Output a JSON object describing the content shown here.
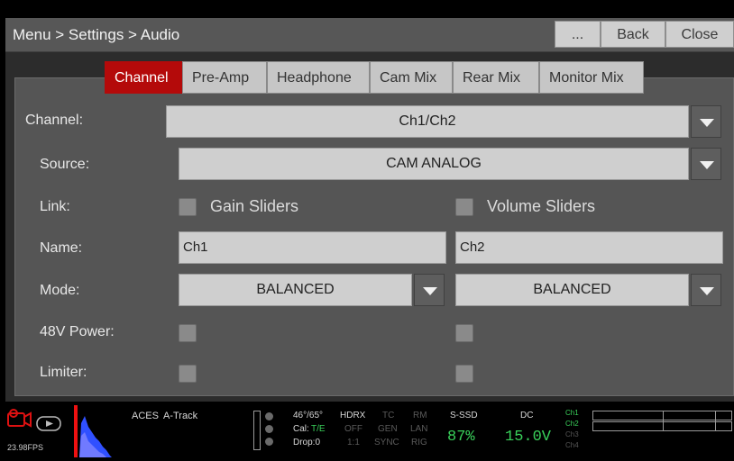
{
  "titlebar": {
    "title": "Menu > Settings > Audio",
    "more_label": "...",
    "back_label": "Back",
    "close_label": "Close"
  },
  "tabs": [
    {
      "label": "Channel",
      "active": true
    },
    {
      "label": "Pre-Amp",
      "active": false
    },
    {
      "label": "Headphone",
      "active": false
    },
    {
      "label": "Cam Mix",
      "active": false
    },
    {
      "label": "Rear Mix",
      "active": false
    },
    {
      "label": "Monitor Mix",
      "active": false
    }
  ],
  "form": {
    "channel_label": "Channel:",
    "channel_value": "Ch1/Ch2",
    "source_label": "Source:",
    "source_value": "CAM ANALOG",
    "link_label": "Link:",
    "gain_sliders_label": "Gain Sliders",
    "volume_sliders_label": "Volume Sliders",
    "name_label": "Name:",
    "name_ch1": "Ch1",
    "name_ch2": "Ch2",
    "mode_label": "Mode:",
    "mode_ch1": "BALANCED",
    "mode_ch2": "BALANCED",
    "power_label": "48V Power:",
    "limiter_label": "Limiter:"
  },
  "status": {
    "fps": "23.98FPS",
    "aces": "ACES",
    "atrack": "A-Track",
    "temp": "46°/65°",
    "cal_prefix": "Cal:",
    "cal_value": "T/E",
    "drop": "Drop:0",
    "hdrx": "HDRX",
    "hdrx_val": "OFF",
    "hdrx_ratio": "1:1",
    "tc": "TC",
    "gen": "GEN",
    "sync": "SYNC",
    "rm": "RM",
    "lan": "LAN",
    "rig": "RIG",
    "media": "S-SSD",
    "media_pct": "87%",
    "power_src": "DC",
    "voltage": "15.0V",
    "channels": [
      "Ch1",
      "Ch2",
      "Ch3",
      "Ch4"
    ]
  },
  "colors": {
    "accent_red": "#b40a0a",
    "status_green": "#39d05a"
  },
  "icons": [
    "camera-record-icon",
    "play-icon",
    "status-dot-icon"
  ]
}
